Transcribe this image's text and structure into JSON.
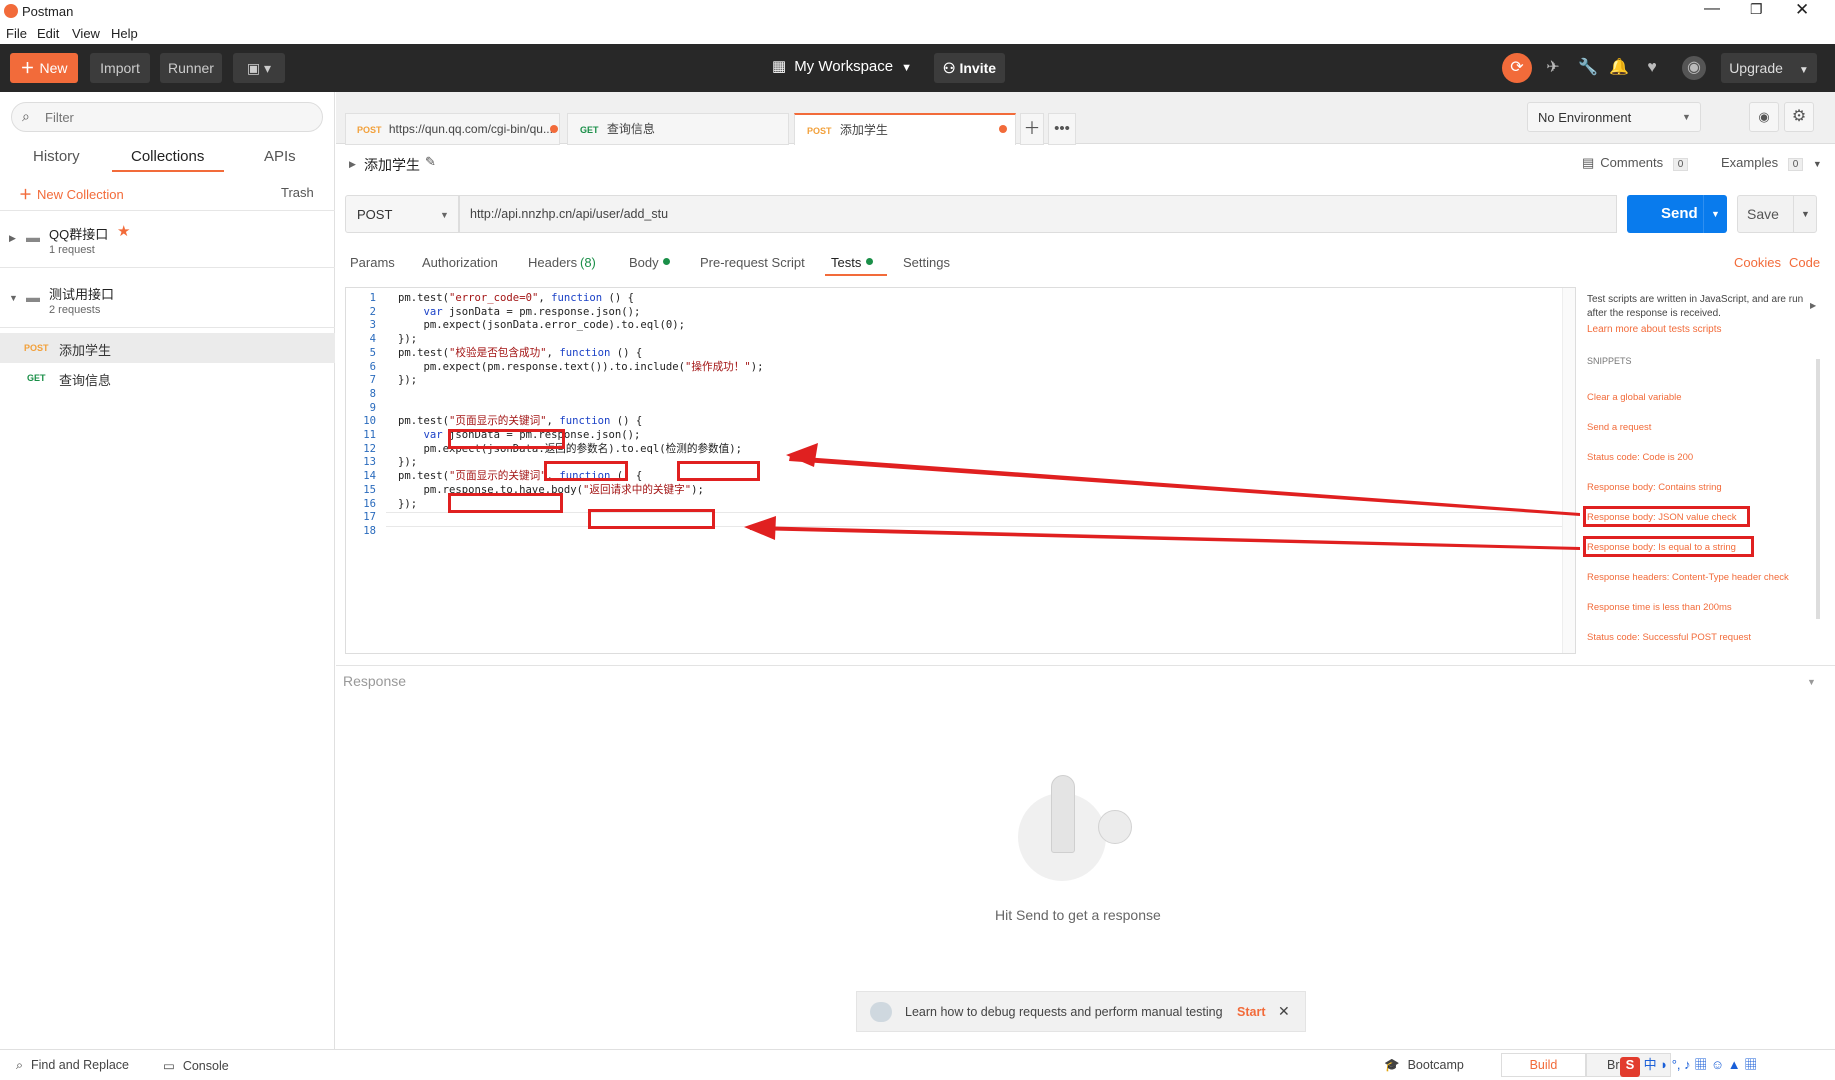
{
  "app": {
    "title": "Postman"
  },
  "menu": [
    "File",
    "Edit",
    "View",
    "Help"
  ],
  "toolbar": {
    "new": "New",
    "import": "Import",
    "runner": "Runner",
    "workspace": "My Workspace",
    "invite": "Invite",
    "upgrade": "Upgrade"
  },
  "sidebar": {
    "filter_placeholder": "Filter",
    "tabs": [
      "History",
      "Collections",
      "APIs"
    ],
    "new_collection": "New Collection",
    "trash": "Trash",
    "collections": [
      {
        "name": "QQ群接口",
        "count": "1 request"
      },
      {
        "name": "测试用接口",
        "count": "2 requests"
      }
    ],
    "requests": [
      {
        "method": "POST",
        "name": "添加学生"
      },
      {
        "method": "GET",
        "name": "查询信息"
      }
    ]
  },
  "tabs": [
    {
      "method": "POST",
      "label": "https://qun.qq.com/cgi-bin/qu..."
    },
    {
      "method": "GET",
      "label": "查询信息"
    },
    {
      "method": "POST",
      "label": "添加学生"
    }
  ],
  "environment": "No Environment",
  "request": {
    "name": "添加学生",
    "comments": "Comments",
    "comments_count": "0",
    "examples": "Examples",
    "examples_count": "0",
    "method": "POST",
    "url": "http://api.nnzhp.cn/api/user/add_stu",
    "send": "Send",
    "save": "Save",
    "subtabs": [
      "Params",
      "Authorization",
      "Headers",
      "(8)",
      "Body",
      "Pre-request Script",
      "Tests",
      "Settings"
    ],
    "cookies": "Cookies",
    "code": "Code"
  },
  "code_lines": [
    "pm.test(\"error_code=0\", function () {",
    "    var jsonData = pm.response.json();",
    "    pm.expect(jsonData.error_code).to.eql(0);",
    "});",
    "pm.test(\"校验是否包含成功\", function () {",
    "    pm.expect(pm.response.text()).to.include(\"操作成功！\");",
    "});",
    "",
    "",
    "pm.test(\"页面显示的关键词\", function () {",
    "    var jsonData = pm.response.json();",
    "    pm.expect(jsonData.返回的参数名).to.eql(检测的参数值);",
    "});",
    "pm.test(\"页面显示的关键词\", function () {",
    "    pm.response.to.have.body(\"返回请求中的关键字\");",
    "});",
    "",
    ""
  ],
  "snippets": {
    "intro": "Test scripts are written in JavaScript, and are run after the response is received.",
    "learn": "Learn more about tests scripts",
    "header": "SNIPPETS",
    "items": [
      "Clear a global variable",
      "Send a request",
      "Status code: Code is 200",
      "Response body: Contains string",
      "Response body: JSON value check",
      "Response body: Is equal to a string",
      "Response headers: Content-Type header check",
      "Response time is less than 200ms",
      "Status code: Successful POST request"
    ]
  },
  "response": {
    "label": "Response",
    "empty": "Hit Send to get a response"
  },
  "banner": {
    "text": "Learn how to debug requests and perform manual testing",
    "start": "Start"
  },
  "status": {
    "find": "Find and Replace",
    "console": "Console",
    "bootcamp": "Bootcamp",
    "build": "Build",
    "browse": "Br"
  },
  "colors": {
    "accent": "#f26b3a",
    "send": "#097bed",
    "annotation": "#e02020"
  }
}
